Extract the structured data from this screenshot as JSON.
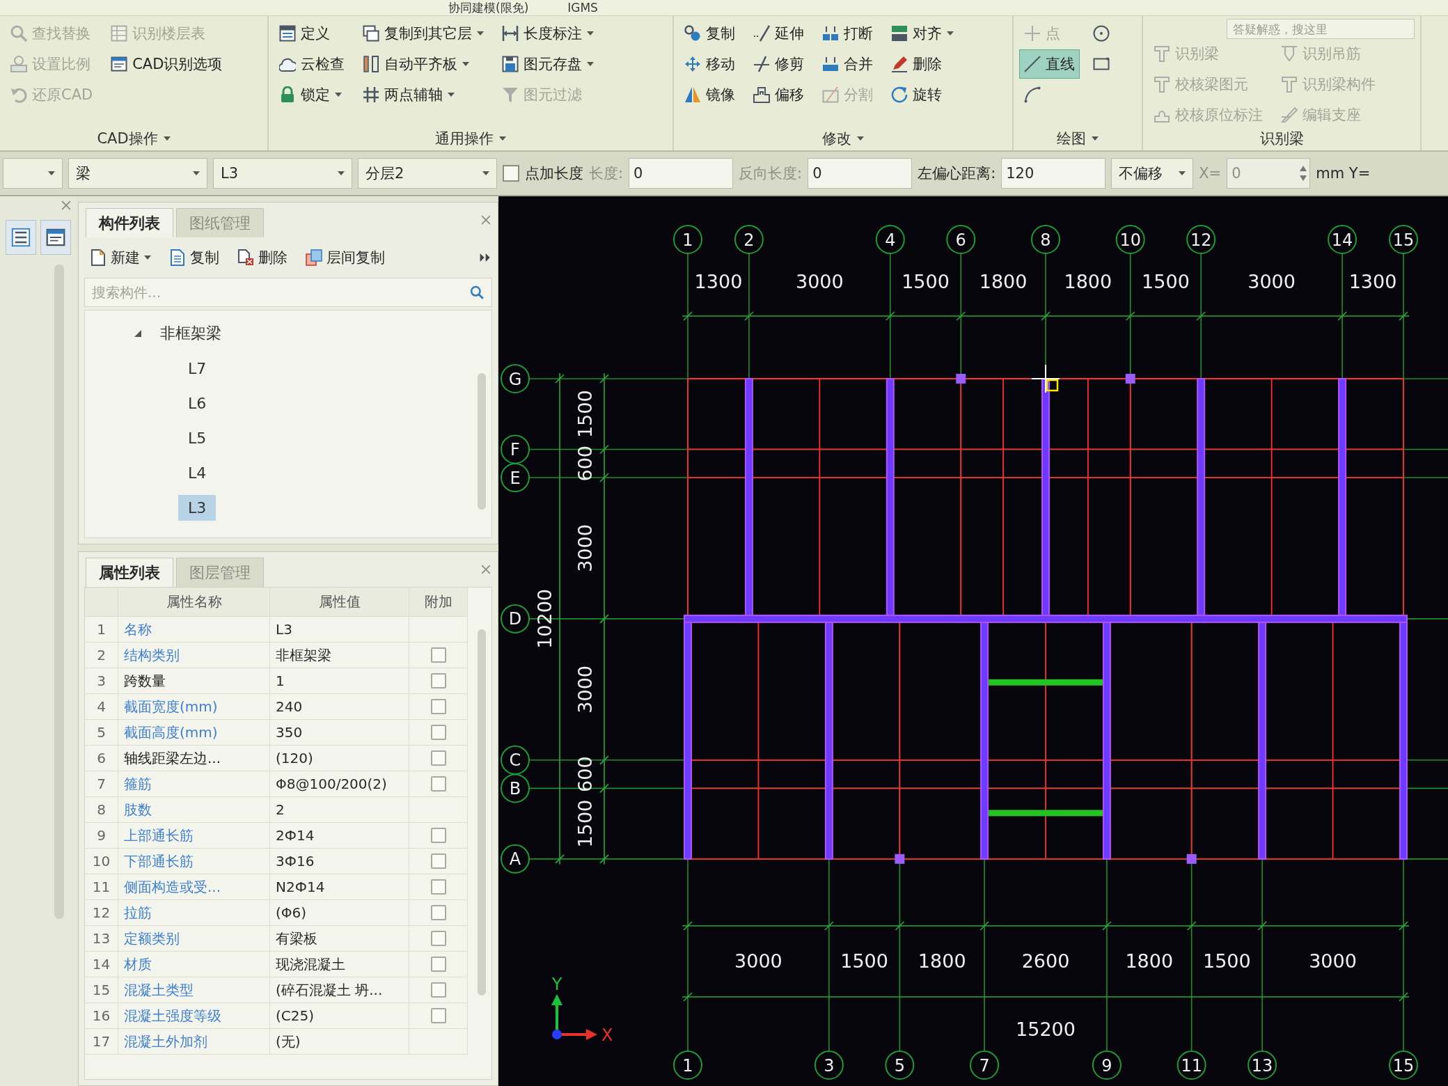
{
  "title_bar": {
    "tabs": [
      {
        "label": "协同建模(限免)"
      },
      {
        "label": "IGMS"
      }
    ]
  },
  "ribbon": {
    "groups": [
      {
        "label": "CAD操作",
        "has_menu": true,
        "columns": [
          [
            {
              "label": "查找替换",
              "disabled": true,
              "has_menu": false
            },
            {
              "label": "设置比例",
              "disabled": true,
              "has_menu": false
            },
            {
              "label": "还原CAD",
              "disabled": true,
              "has_menu": false
            }
          ],
          [
            {
              "label": "识别楼层表",
              "disabled": true,
              "has_menu": false
            },
            {
              "label": "CAD识别选项",
              "disabled": false,
              "has_menu": false
            }
          ]
        ]
      },
      {
        "label": "通用操作",
        "has_menu": true,
        "columns": [
          [
            {
              "label": "定义",
              "disabled": false,
              "has_menu": false
            },
            {
              "label": "云检查",
              "disabled": false,
              "has_menu": false
            },
            {
              "label": "锁定",
              "disabled": false,
              "has_menu": true
            }
          ],
          [
            {
              "label": "复制到其它层",
              "disabled": false,
              "has_menu": true
            },
            {
              "label": "自动平齐板",
              "disabled": false,
              "has_menu": true
            },
            {
              "label": "两点辅轴",
              "disabled": false,
              "has_menu": true
            }
          ],
          [
            {
              "label": "长度标注",
              "disabled": false,
              "has_menu": true
            },
            {
              "label": "图元存盘",
              "disabled": false,
              "has_menu": true
            },
            {
              "label": "图元过滤",
              "disabled": true,
              "has_menu": false
            }
          ]
        ]
      },
      {
        "label": "修改",
        "has_menu": true,
        "columns": [
          [
            {
              "label": "复制",
              "disabled": false,
              "has_menu": false
            },
            {
              "label": "移动",
              "disabled": false,
              "has_menu": false
            },
            {
              "label": "镜像",
              "disabled": false,
              "has_menu": false
            }
          ],
          [
            {
              "label": "延伸",
              "disabled": false,
              "has_menu": false
            },
            {
              "label": "修剪",
              "disabled": false,
              "has_menu": false
            },
            {
              "label": "偏移",
              "disabled": false,
              "has_menu": false
            }
          ],
          [
            {
              "label": "打断",
              "disabled": false,
              "has_menu": false
            },
            {
              "label": "合并",
              "disabled": false,
              "has_menu": false
            },
            {
              "label": "分割",
              "disabled": true,
              "has_menu": false
            }
          ],
          [
            {
              "label": "对齐",
              "disabled": false,
              "has_menu": true
            },
            {
              "label": "删除",
              "disabled": false,
              "has_menu": false
            },
            {
              "label": "旋转",
              "disabled": false,
              "has_menu": false
            }
          ]
        ]
      },
      {
        "label": "绘图",
        "has_menu": true,
        "columns": [
          [
            {
              "label": "点",
              "disabled": true,
              "selected": false
            },
            {
              "label": "直线",
              "disabled": false,
              "selected": true
            },
            {
              "disabled": false,
              "selected": false
            }
          ],
          [
            {
              "disabled": false,
              "selected": false
            },
            {
              "disabled": false,
              "selected": false
            }
          ]
        ]
      },
      {
        "label": "识别梁",
        "has_menu": false,
        "search": {
          "placeholder": "答疑解惑，搜这里"
        },
        "columns": [
          [
            {
              "label": "识别梁",
              "disabled": true,
              "has_menu": false
            },
            {
              "label": "校核梁图元",
              "disabled": true,
              "has_menu": false
            },
            {
              "label": "校核原位标注",
              "disabled": true,
              "has_menu": false
            }
          ],
          [
            {
              "label": "识别吊筋",
              "disabled": true,
              "has_menu": false
            },
            {
              "label": "识别梁构件",
              "disabled": true,
              "has_menu": false
            },
            {
              "label": "编辑支座",
              "disabled": true,
              "has_menu": false
            }
          ]
        ]
      }
    ]
  },
  "property_bar": [
    {
      "kind": "dropdown"
    },
    {
      "kind": "dropdown",
      "value": "梁"
    },
    {
      "kind": "dropdown",
      "value": "L3"
    },
    {
      "kind": "dropdown",
      "value": "分层2"
    },
    {
      "kind": "checkbox",
      "label": "点加长度",
      "checked": false
    },
    {
      "kind": "field",
      "label": "长度:",
      "value": "0",
      "disabled": true
    },
    {
      "kind": "field",
      "label": "反向长度:",
      "value": "0",
      "disabled": true
    },
    {
      "kind": "field",
      "label": "左偏心距离:",
      "value": "120",
      "disabled": false
    },
    {
      "kind": "dropdown",
      "value": "不偏移"
    },
    {
      "kind": "spinner",
      "label": "X=",
      "value": "0",
      "disabled": true
    },
    {
      "kind": "label",
      "text": "mm Y="
    }
  ],
  "component_panel": {
    "tabs": [
      {
        "label": "构件列表",
        "selected": true
      },
      {
        "label": "图纸管理",
        "selected": false
      }
    ],
    "toolbar": [
      {
        "label": "新建",
        "has_menu": true
      },
      {
        "label": "复制",
        "has_menu": false
      },
      {
        "label": "删除",
        "has_menu": false
      },
      {
        "label": "层间复制",
        "has_menu": false
      }
    ],
    "search": {
      "placeholder": "搜索构件..."
    },
    "tree": [
      {
        "label": "非框架梁",
        "expanded": true,
        "selected": false,
        "children": [
          {
            "label": "L7",
            "selected": false
          },
          {
            "label": "L6",
            "selected": false
          },
          {
            "label": "L5",
            "selected": false
          },
          {
            "label": "L4",
            "selected": false
          },
          {
            "label": "L3",
            "selected": true
          }
        ]
      }
    ]
  },
  "properties_panel": {
    "tabs": [
      {
        "label": "属性列表",
        "selected": true
      },
      {
        "label": "图层管理",
        "selected": false
      }
    ],
    "columns": [
      "属性名称",
      "属性值",
      "附加"
    ],
    "rows": [
      {
        "index": "1",
        "name": "名称",
        "value": "L3",
        "public": true
      },
      {
        "index": "2",
        "name": "结构类别",
        "value": "非框架梁",
        "public": true,
        "checked": false
      },
      {
        "index": "3",
        "name": "跨数量",
        "value": "1",
        "public": false,
        "checked": false
      },
      {
        "index": "4",
        "name": "截面宽度(mm)",
        "value": "240",
        "public": true,
        "checked": false
      },
      {
        "index": "5",
        "name": "截面高度(mm)",
        "value": "350",
        "public": true,
        "checked": false
      },
      {
        "index": "6",
        "name": "轴线距梁左边...",
        "value": "(120)",
        "public": false,
        "checked": false
      },
      {
        "index": "7",
        "name": "箍筋",
        "value": "Φ8@100/200(2)",
        "public": true,
        "checked": false
      },
      {
        "index": "8",
        "name": "肢数",
        "value": "2",
        "public": true
      },
      {
        "index": "9",
        "name": "上部通长筋",
        "value": "2Ф14",
        "public": true,
        "checked": false
      },
      {
        "index": "10",
        "name": "下部通长筋",
        "value": "3Ф16",
        "public": true,
        "checked": false
      },
      {
        "index": "11",
        "name": "侧面构造或受...",
        "value": "N2Ф14",
        "public": true,
        "checked": false
      },
      {
        "index": "12",
        "name": "拉筋",
        "value": "(Φ6)",
        "public": true,
        "checked": false
      },
      {
        "index": "13",
        "name": "定额类别",
        "value": "有梁板",
        "public": true,
        "checked": false
      },
      {
        "index": "14",
        "name": "材质",
        "value": "现浇混凝土",
        "public": true,
        "checked": false
      },
      {
        "index": "15",
        "name": "混凝土类型",
        "value": "(碎石混凝土 坍...",
        "public": true,
        "checked": false
      },
      {
        "index": "16",
        "name": "混凝土强度等级",
        "value": "(C25)",
        "public": true,
        "checked": false
      },
      {
        "index": "17",
        "name": "混凝土外加剂",
        "value": "(无)",
        "public": true
      }
    ]
  },
  "canvas": {
    "top_axes": [
      "1",
      "2",
      "4",
      "6",
      "8",
      "10",
      "12",
      "14",
      "15"
    ],
    "top_dimensions": [
      "1300",
      "3000",
      "1500",
      "1800",
      "1800",
      "1500",
      "3000",
      "1300"
    ],
    "left_axes": [
      "G",
      "F",
      "E",
      "D",
      "C",
      "B",
      "A"
    ],
    "left_dimensions": [
      "1500",
      "600",
      "3000",
      "3000",
      "600",
      "1500"
    ],
    "left_total": "10200",
    "bottom_dimensions": [
      "3000",
      "1500",
      "1800",
      "2600",
      "1800",
      "1500",
      "3000"
    ],
    "bottom_total": "15200",
    "bottom_axes": [
      "1",
      "3",
      "5",
      "7",
      "9",
      "11",
      "13",
      "15"
    ],
    "coordinate_axes": {
      "x": "X",
      "y": "Y"
    }
  }
}
